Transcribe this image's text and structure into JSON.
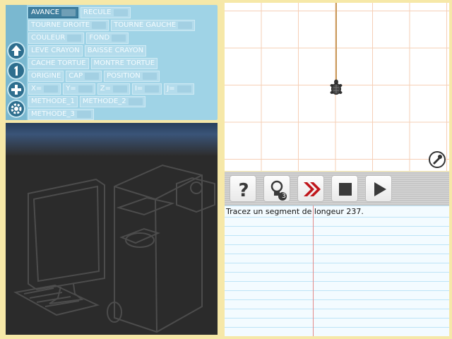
{
  "commands": {
    "rows": [
      [
        {
          "label": "AVANCE",
          "slot": true,
          "active": true
        },
        {
          "label": "RECULE",
          "slot": true
        }
      ],
      [
        {
          "label": "TOURNE DROITE",
          "slot": true
        },
        {
          "label": "TOURNE GAUCHE",
          "slot": true
        }
      ],
      [
        {
          "label": "COULEUR",
          "slot": true
        },
        {
          "label": "FOND",
          "slot": true
        }
      ],
      [
        {
          "label": "LEVE CRAYON"
        },
        {
          "label": "BAISSE CRAYON"
        }
      ],
      [
        {
          "label": "CACHE TORTUE"
        },
        {
          "label": "MONTRE TORTUE"
        }
      ],
      [
        {
          "label": "ORIGINE"
        },
        {
          "label": "CAP",
          "slot": true
        },
        {
          "label": "POSITION",
          "slot": true
        }
      ],
      [
        {
          "label": "X=",
          "slot": true
        },
        {
          "label": "Y=",
          "slot": true
        },
        {
          "label": "Z=",
          "slot": true
        },
        {
          "label": "I=",
          "slot": true
        },
        {
          "label": "J=",
          "slot": true
        }
      ],
      [
        {
          "label": "METHODE_1"
        },
        {
          "label": "METHODE_2",
          "slot": true
        }
      ],
      [
        {
          "label": "METHODE_3",
          "slot": true
        }
      ]
    ]
  },
  "sidebar": {
    "icons": [
      "arrow-up-icon",
      "number-one-icon",
      "plus-icon",
      "gear-icon"
    ]
  },
  "toolbar": {
    "hint_count": "3",
    "icons": [
      "help-icon",
      "hint-bulb-icon",
      "fast-forward-icon",
      "stop-icon",
      "play-icon"
    ]
  },
  "instruction": {
    "text": "Tracez un segment de longeur 237."
  },
  "colors": {
    "background": "#f6e8a8",
    "panel": "#9fd3e6",
    "active_block": "#3f7f9e",
    "grid": "#f6cfb6",
    "trail": "#c99a5c",
    "fast_forward": "#c0161b"
  }
}
